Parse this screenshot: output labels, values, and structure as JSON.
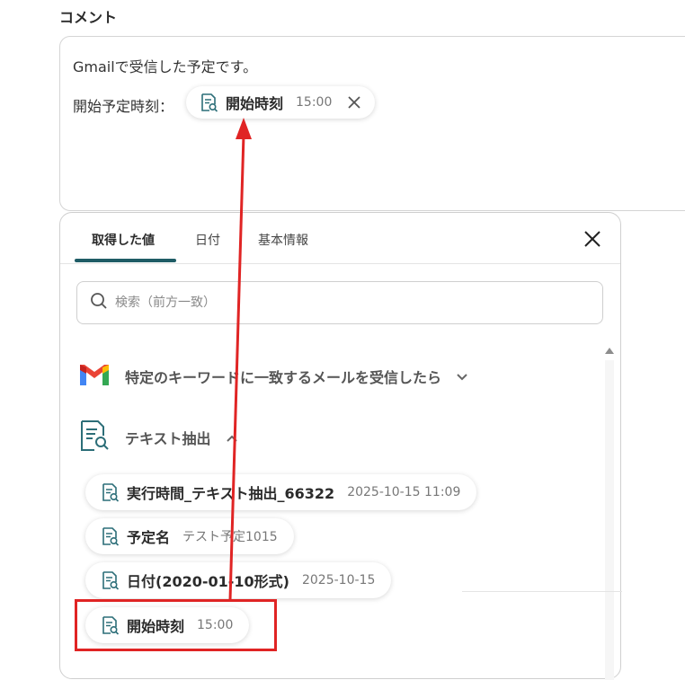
{
  "section_label": "コメント",
  "comment": {
    "line1": "Gmailで受信した予定です。",
    "line2_label": "開始予定時刻：",
    "chip": {
      "label": "開始時刻",
      "value": "15:00",
      "icon": "doc-search-icon"
    }
  },
  "picker": {
    "tabs": [
      {
        "label": "取得した値",
        "active": true
      },
      {
        "label": "日付",
        "active": false
      },
      {
        "label": "基本情報",
        "active": false
      }
    ],
    "search_placeholder": "検索（前方一致）",
    "groups": [
      {
        "label": "特定のキーワードに一致するメールを受信したら",
        "icon": "gmail-icon",
        "expanded": false
      },
      {
        "label": "テキスト抽出",
        "icon": "doc-search-icon",
        "expanded": true
      }
    ],
    "items": [
      {
        "label": "実行時間_テキスト抽出_66322",
        "value": "2025-10-15 11:09"
      },
      {
        "label": "予定名",
        "value": "テスト予定1015"
      },
      {
        "label": "日付(2020-01-10形式)",
        "value": "2025-10-15"
      },
      {
        "label": "開始時刻",
        "value": "15:00"
      }
    ]
  },
  "colors": {
    "accent": "#1f5c66",
    "annotation": "#e02424",
    "icon": "#2c6e78"
  }
}
